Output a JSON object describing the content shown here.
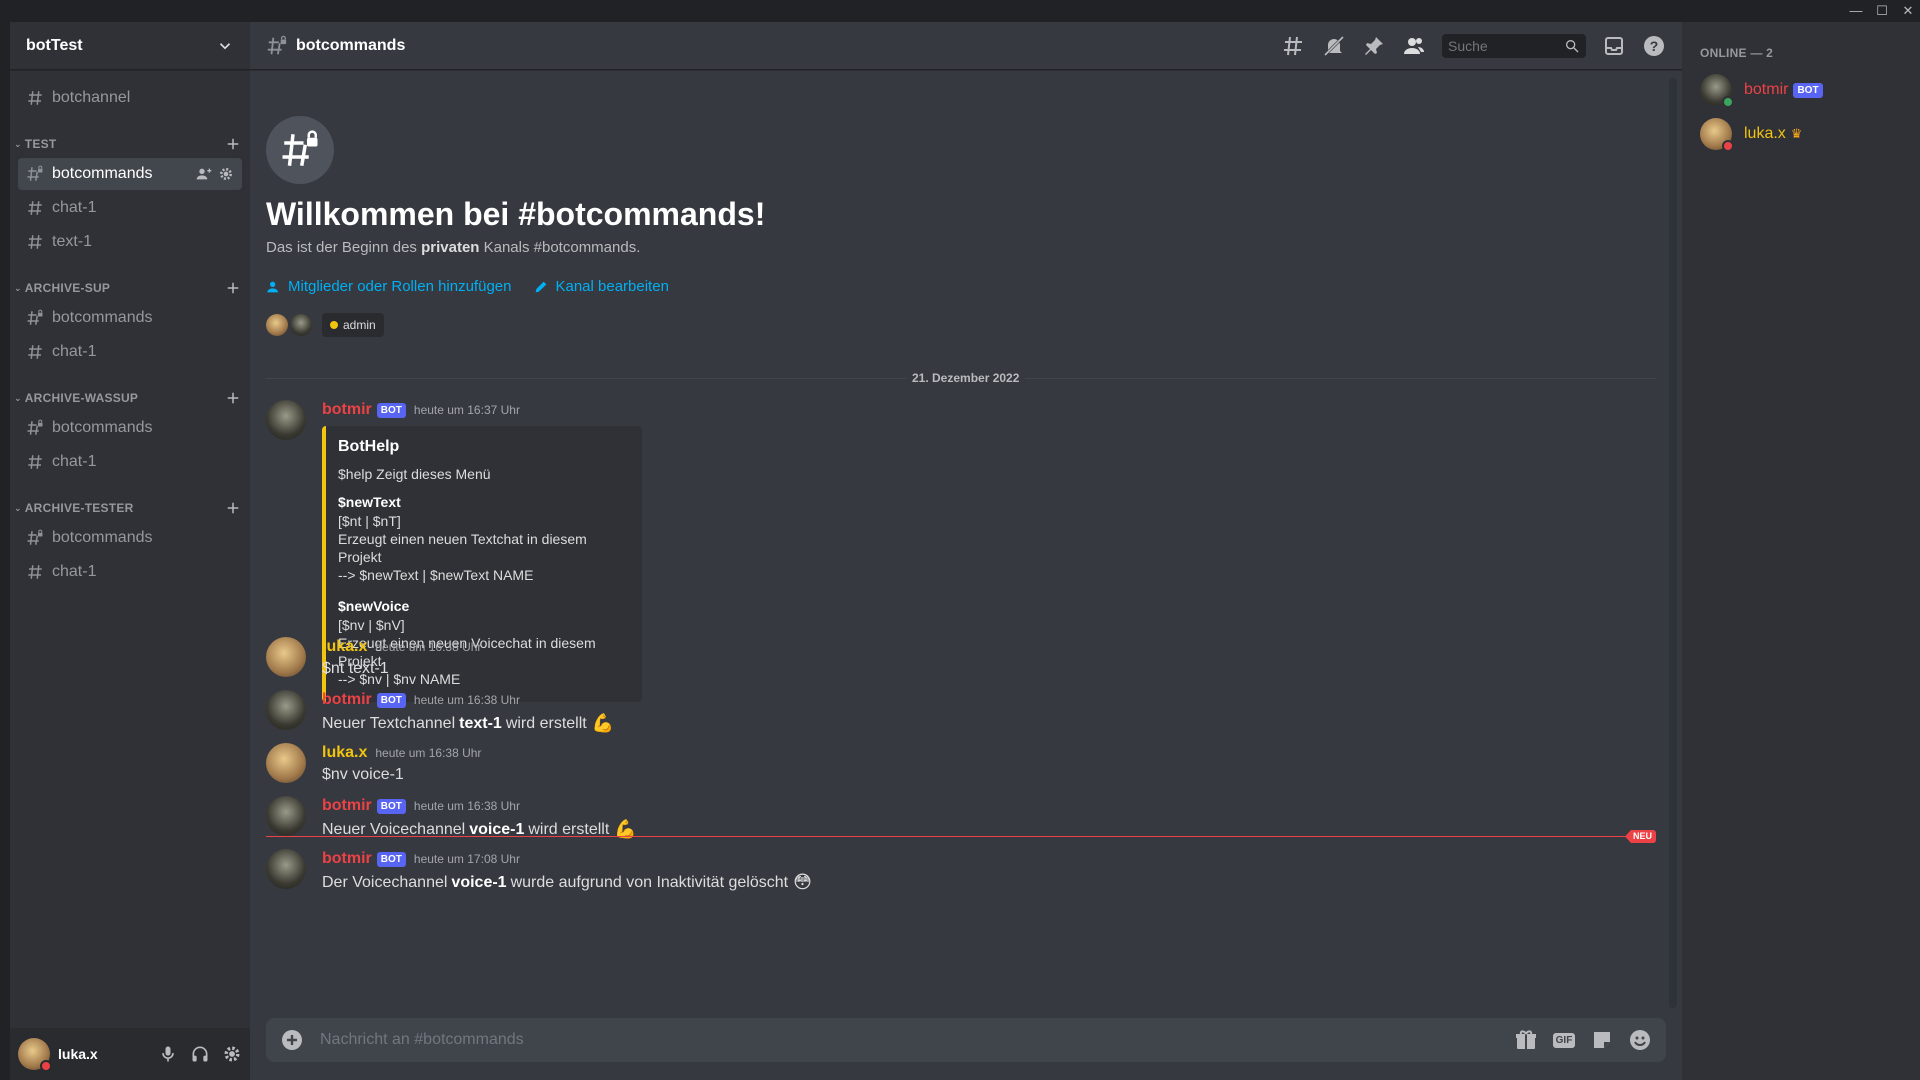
{
  "window": {
    "minimize": "—",
    "maximize": "☐",
    "close": "✕"
  },
  "server": {
    "name": "botTest"
  },
  "sidebar": {
    "top_channels": [
      {
        "name": "botchannel"
      }
    ],
    "categories": [
      {
        "name": "TEST",
        "channels": [
          {
            "name": "botcommands",
            "active": true
          },
          {
            "name": "chat-1"
          },
          {
            "name": "text-1"
          }
        ]
      },
      {
        "name": "ARCHIVE-SUP",
        "channels": [
          {
            "name": "botcommands"
          },
          {
            "name": "chat-1"
          }
        ]
      },
      {
        "name": "ARCHIVE-WASSUP",
        "channels": [
          {
            "name": "botcommands"
          },
          {
            "name": "chat-1"
          }
        ]
      },
      {
        "name": "ARCHIVE-TESTER",
        "channels": [
          {
            "name": "botcommands"
          },
          {
            "name": "chat-1"
          }
        ]
      }
    ]
  },
  "user_panel": {
    "username": "luka.x"
  },
  "header": {
    "channel": "botcommands",
    "search_placeholder": "Suche"
  },
  "welcome": {
    "title": "Willkommen bei #botcommands!",
    "sub_prefix": "Das ist der Beginn des ",
    "sub_bold": "privaten",
    "sub_suffix": " Kanals #botcommands.",
    "link_members": "Mitglieder oder Rollen hinzufügen",
    "link_edit": "Kanal bearbeiten",
    "role": "admin"
  },
  "date_divider": "21. Dezember 2022",
  "messages": [
    {
      "author": "botmir",
      "bot": true,
      "bot_tag": "BOT",
      "time": "heute um 16:37 Uhr",
      "embed": {
        "title": "BotHelp",
        "description": "$help Zeigt dieses Menü",
        "fields": [
          {
            "name": "$newText",
            "lines": [
              "[$nt | $nT]",
              "Erzeugt einen neuen Textchat in diesem Projekt",
              "--> $newText | $newText NAME"
            ]
          },
          {
            "name": "$newVoice",
            "lines": [
              "[$nv | $nV]",
              "Erzeugt einen neuen Voicechat in diesem Projekt",
              "--> $nv | $nv NAME"
            ]
          }
        ]
      }
    },
    {
      "author": "luka.x",
      "time": "heute um 16:38 Uhr",
      "text": "$nt text-1"
    },
    {
      "author": "botmir",
      "bot_tag": "BOT",
      "time": "heute um 16:38 Uhr",
      "pre": "Neuer Textchannel",
      "bold": "text-1",
      "post": "wird erstellt",
      "emoji": "💪"
    },
    {
      "author": "luka.x",
      "time": "heute um 16:38 Uhr",
      "text": "$nv voice-1"
    },
    {
      "author": "botmir",
      "bot_tag": "BOT",
      "time": "heute um 16:38 Uhr",
      "pre": "Neuer Voicechannel",
      "bold": "voice-1",
      "post": "wird erstellt",
      "emoji": "💪"
    },
    {
      "author": "botmir",
      "bot_tag": "BOT",
      "time": "heute um 17:08 Uhr",
      "pre": "Der Voicechannel",
      "bold": "voice-1",
      "post": "wurde aufgrund von Inaktivität gelöscht",
      "emoji": "😳"
    }
  ],
  "new_marker": "NEU",
  "composer": {
    "placeholder": "Nachricht an #botcommands",
    "gif": "GIF"
  },
  "members": {
    "heading": "ONLINE — 2",
    "list": [
      {
        "name": "botmir",
        "tag": "BOT"
      },
      {
        "name": "luka.x"
      }
    ]
  },
  "colors": {
    "accent": "#5865f2",
    "bot_name": "#ed4245",
    "owner_name": "#f1c40f",
    "link": "#00aff4"
  }
}
